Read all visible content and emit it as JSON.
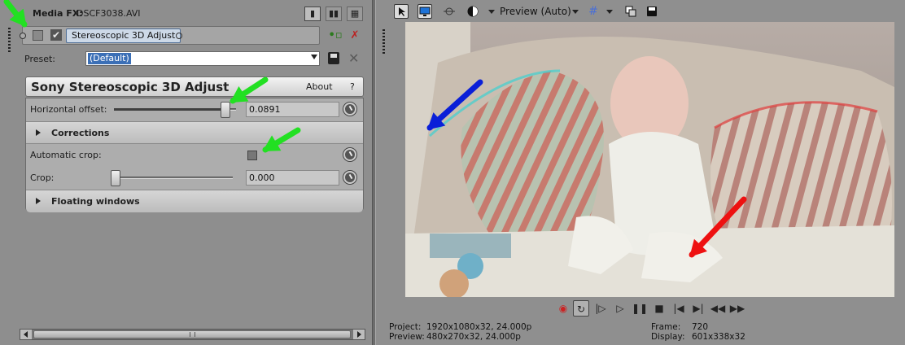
{
  "media_fx": {
    "title_label": "Media FX:",
    "file_name": "DSCF3038.AVI",
    "plugin_chain_name": "Stereoscopic 3D Adjust"
  },
  "preset": {
    "label": "Preset:",
    "value": "(Default)"
  },
  "plugin": {
    "title": "Sony Stereoscopic 3D Adjust",
    "about_label": "About",
    "help_label": "?"
  },
  "params": {
    "horizontal_offset": {
      "label": "Horizontal offset:",
      "value": "0.0891",
      "slider_fraction": 0.95
    },
    "corrections": {
      "label": "Corrections"
    },
    "automatic_crop": {
      "label": "Automatic crop:",
      "checked": false
    },
    "crop": {
      "label": "Crop:",
      "value": "0.000",
      "slider_fraction": 0.0
    },
    "floating_windows": {
      "label": "Floating windows"
    }
  },
  "preview": {
    "mode": "Preview (Auto)"
  },
  "status": {
    "project_label": "Project:",
    "project_value": "1920x1080x32, 24.000p",
    "preview_label": "Preview:",
    "preview_value": "480x270x32, 24.000p",
    "frame_label": "Frame:",
    "frame_value": "720",
    "display_label": "Display:",
    "display_value": "601x338x32"
  },
  "annotations": {
    "green_arrow_color": "#22e022",
    "blue_arrow_color": "#0a1fd8",
    "red_arrow_color": "#ee1111"
  },
  "icons": [
    "play-icon",
    "pause-icon",
    "stop-icon",
    "loop-icon",
    "record-icon",
    "save-icon",
    "delete-icon",
    "animate-icon"
  ]
}
